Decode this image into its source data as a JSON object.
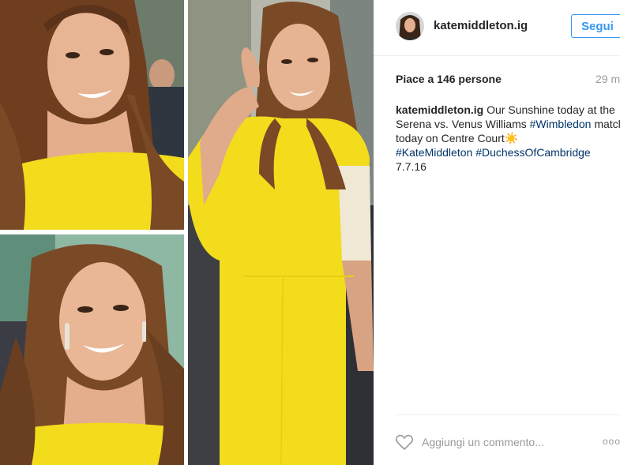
{
  "post": {
    "username": "katemiddleton.ig",
    "follow_label": "Segui",
    "likes_text": "Piace a 146 persone",
    "timestamp": "29 m",
    "caption": {
      "author": "katemiddleton.ig",
      "text_1": " Our Sunshine today at the Serena vs. Venus Williams ",
      "tag_wimbledon": "#Wimbledon",
      "text_2": " match today on Centre Court☀️",
      "tag_kate": "#KateMiddleton",
      "tag_duchess": "#DuchessOfCambridge",
      "date": "7.7.16"
    },
    "comment_placeholder": "Aggiungi un commento...",
    "more_label": "ooo"
  },
  "colors": {
    "accent": "#3897f0",
    "hashtag": "#003569",
    "dress_yellow": "#f2dc1c",
    "hair": "#7a4a26"
  },
  "icons": [
    "heart-icon",
    "more-options-icon"
  ]
}
